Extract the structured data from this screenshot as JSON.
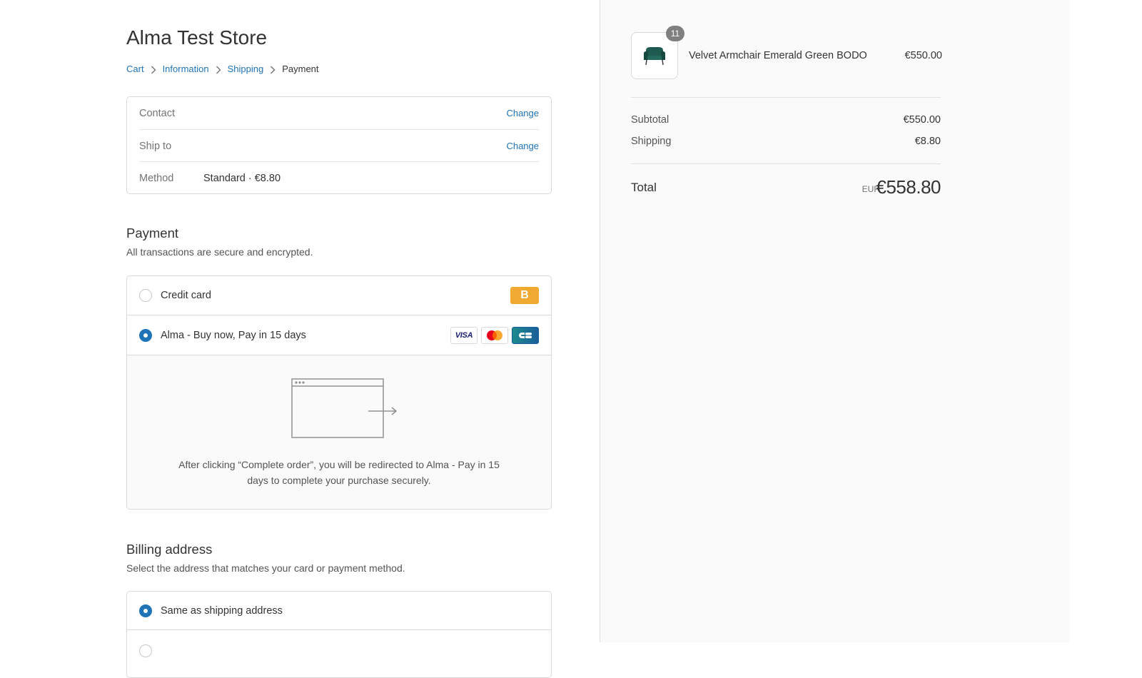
{
  "store": {
    "title": "Alma Test Store"
  },
  "breadcrumb": {
    "cart": "Cart",
    "information": "Information",
    "shipping": "Shipping",
    "payment": "Payment"
  },
  "review": {
    "contact_label": "Contact",
    "contact_change": "Change",
    "ship_to_label": "Ship to",
    "ship_to_change": "Change",
    "method_label": "Method",
    "method_value": "Standard · €8.80"
  },
  "payment": {
    "title": "Payment",
    "subtitle": "All transactions are secure and encrypted.",
    "options": [
      {
        "label": "Credit card",
        "selected": false,
        "badge": "B"
      },
      {
        "label": "Alma - Buy now, Pay in 15 days",
        "selected": true,
        "logos": [
          "visa",
          "mastercard",
          "cb"
        ]
      }
    ],
    "visa_text": "VISA",
    "redirect_text": "After clicking “Complete order”, you will be redirected to Alma - Pay in 15 days to complete your purchase securely."
  },
  "billing": {
    "title": "Billing address",
    "subtitle": "Select the address that matches your card or payment method.",
    "options": [
      {
        "label": "Same as shipping address",
        "selected": true
      }
    ]
  },
  "summary": {
    "item": {
      "name": "Velvet Armchair Emerald Green BODO",
      "price": "€550.00",
      "quantity": "11"
    },
    "subtotal_label": "Subtotal",
    "subtotal_value": "€550.00",
    "shipping_label": "Shipping",
    "shipping_value": "€8.80",
    "total_label": "Total",
    "total_currency": "EUR",
    "total_value": "€558.80"
  },
  "colors": {
    "link": "#1f73b7",
    "badge_orange": "#f0a931",
    "sidebar_bg": "#fafafa"
  }
}
